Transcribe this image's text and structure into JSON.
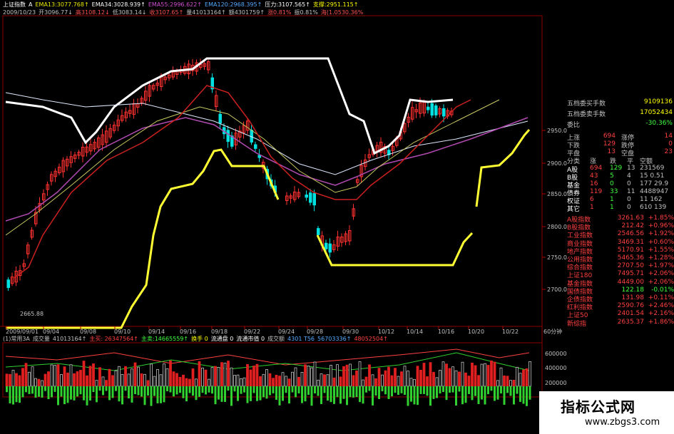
{
  "header": {
    "line1": [
      {
        "text": "上证指数",
        "color": "#ffffff"
      },
      {
        "text": "A",
        "color": "#ffffff"
      },
      {
        "text": "EMA13:3077.768↑",
        "color": "#e8e800"
      },
      {
        "text": "EMA34:3028.939↑",
        "color": "#ffffff"
      },
      {
        "text": "EMA55:2996.622↑",
        "color": "#d24fd2"
      },
      {
        "text": "EMA120:2968.395↑",
        "color": "#55aaff"
      },
      {
        "text": "压力:3107.565↑",
        "color": "#ffffff"
      },
      {
        "text": "支撑:2951.115↑",
        "color": "#ffff00"
      }
    ],
    "line2": [
      {
        "text": "2009/10/23",
        "color": "#c0c0c0"
      },
      {
        "text": "开3096.77↓",
        "color": "#c0c0c0"
      },
      {
        "text": "高3108.12↓",
        "color": "#ff5050"
      },
      {
        "text": "低3083.14↓",
        "color": "#c0c0c0"
      },
      {
        "text": "收3107.65↑",
        "color": "#ff5050"
      },
      {
        "text": "量41013164↑",
        "color": "#c0c0c0"
      },
      {
        "text": "额4301759↑",
        "color": "#c0c0c0"
      },
      {
        "text": "涨0.81%",
        "color": "#ff5050"
      },
      {
        "text": "振0.81%",
        "color": "#c0c0c0"
      },
      {
        "text": "海(1.0530.36%",
        "color": "#ff5050"
      }
    ]
  },
  "price_axis": [
    "2950.0",
    "2900.0",
    "2850.0",
    "2800.0",
    "2750.0",
    "2700.0"
  ],
  "date_axis": [
    "2009/09/01",
    "09/04",
    "09/08",
    "09/10",
    "09/14",
    "09/16",
    "09/18",
    "09/22",
    "09/24",
    "09/28",
    "09/30",
    "10/12",
    "10/14",
    "10/16",
    "10/20",
    "10/22"
  ],
  "interval_label": "60分钟",
  "low_label": "2665.88",
  "volume_header": [
    {
      "text": "(1)常用3A",
      "color": "#c0c0c0"
    },
    {
      "text": "成交量",
      "color": "#c0c0c0"
    },
    {
      "text": "41013164↑",
      "color": "#c0c0c0"
    },
    {
      "text": "主买: 26347564↑",
      "color": "#ff4040"
    },
    {
      "text": "主卖:14665559↑",
      "color": "#40ff40"
    },
    {
      "text": "换手 0",
      "color": "#ffff00"
    },
    {
      "text": "流通盘 0",
      "color": "#ffffff"
    },
    {
      "text": "流通市值 0",
      "color": "#ffffff"
    },
    {
      "text": "成交额",
      "color": "#c0c0c0"
    },
    {
      "text": "4301 T56",
      "color": "#55aaff"
    },
    {
      "text": "56703336↑",
      "color": "#55aaff"
    },
    {
      "text": "48052504↑",
      "color": "#ff4040"
    }
  ],
  "volume_axis": [
    "600000",
    "400000",
    "200000"
  ],
  "panel": {
    "top_rows": [
      {
        "label": "五档委买手数",
        "value": "9109136",
        "color": "#ffff00"
      },
      {
        "label": "五档委卖手数",
        "value": "17052434",
        "color": "#ffff00"
      },
      {
        "label": "委比",
        "value": "-30.36%",
        "color": "#40ff40"
      }
    ],
    "stats": [
      {
        "a": "上涨",
        "av": "694",
        "b": "涨停",
        "bv": "14"
      },
      {
        "a": "下跌",
        "av": "129",
        "b": "跌停",
        "bv": "0"
      },
      {
        "a": "平盘",
        "av": "13",
        "b": "空盘",
        "bv": "23"
      }
    ],
    "table_headers": [
      "分类",
      "涨",
      "跌",
      "平",
      "空额"
    ],
    "table_rows": [
      [
        "A股",
        "694",
        "129",
        "13",
        "231569"
      ],
      [
        "B股",
        "43",
        "5",
        "4",
        "15 0.51"
      ],
      [
        "基金",
        "16",
        "0",
        "0",
        "177 29.9"
      ],
      [
        "债券",
        "119",
        "33",
        "11",
        "4488947"
      ],
      [
        "权证",
        "6",
        "1",
        "0",
        "11 162"
      ],
      [
        "其它",
        "1",
        "1",
        "0",
        "610 139"
      ]
    ],
    "indices": [
      {
        "name": "A股指数",
        "value": "3261.63",
        "change": "+1.85%",
        "color": "#ff4040"
      },
      {
        "name": "B股指数",
        "value": "212.42",
        "change": "+0.96%",
        "color": "#ff4040"
      },
      {
        "name": "工业指数",
        "value": "2546.56",
        "change": "+1.92%",
        "color": "#ff4040"
      },
      {
        "name": "商业指数",
        "value": "3469.31",
        "change": "+0.60%",
        "color": "#ff4040"
      },
      {
        "name": "地产指数",
        "value": "5170.91",
        "change": "+1.55%",
        "color": "#ff4040"
      },
      {
        "name": "公用指数",
        "value": "5465.36",
        "change": "+1.28%",
        "color": "#ff4040"
      },
      {
        "name": "综合指数",
        "value": "2707.50",
        "change": "+1.97%",
        "color": "#ff4040"
      },
      {
        "name": "上证180",
        "value": "7495.71",
        "change": "+2.06%",
        "color": "#ff4040"
      },
      {
        "name": "基金指数",
        "value": "4449.00",
        "change": "+2.06%",
        "color": "#ff4040"
      },
      {
        "name": "国债指数",
        "value": "122.18",
        "change": "-0.01%",
        "color": "#40ff40"
      },
      {
        "name": "企债指数",
        "value": "131.98",
        "change": "+0.11%",
        "color": "#ff4040"
      },
      {
        "name": "红利指数",
        "value": "2590.76",
        "change": "+2.46%",
        "color": "#ff4040"
      },
      {
        "name": "上证50",
        "value": "2401.54",
        "change": "+2.16%",
        "color": "#ff4040"
      },
      {
        "name": "新综指",
        "value": "2635.37",
        "change": "+1.86%",
        "color": "#ff4040"
      }
    ]
  },
  "watermark": {
    "title": "指标公式网",
    "url": "www.zbgs3.com"
  }
}
